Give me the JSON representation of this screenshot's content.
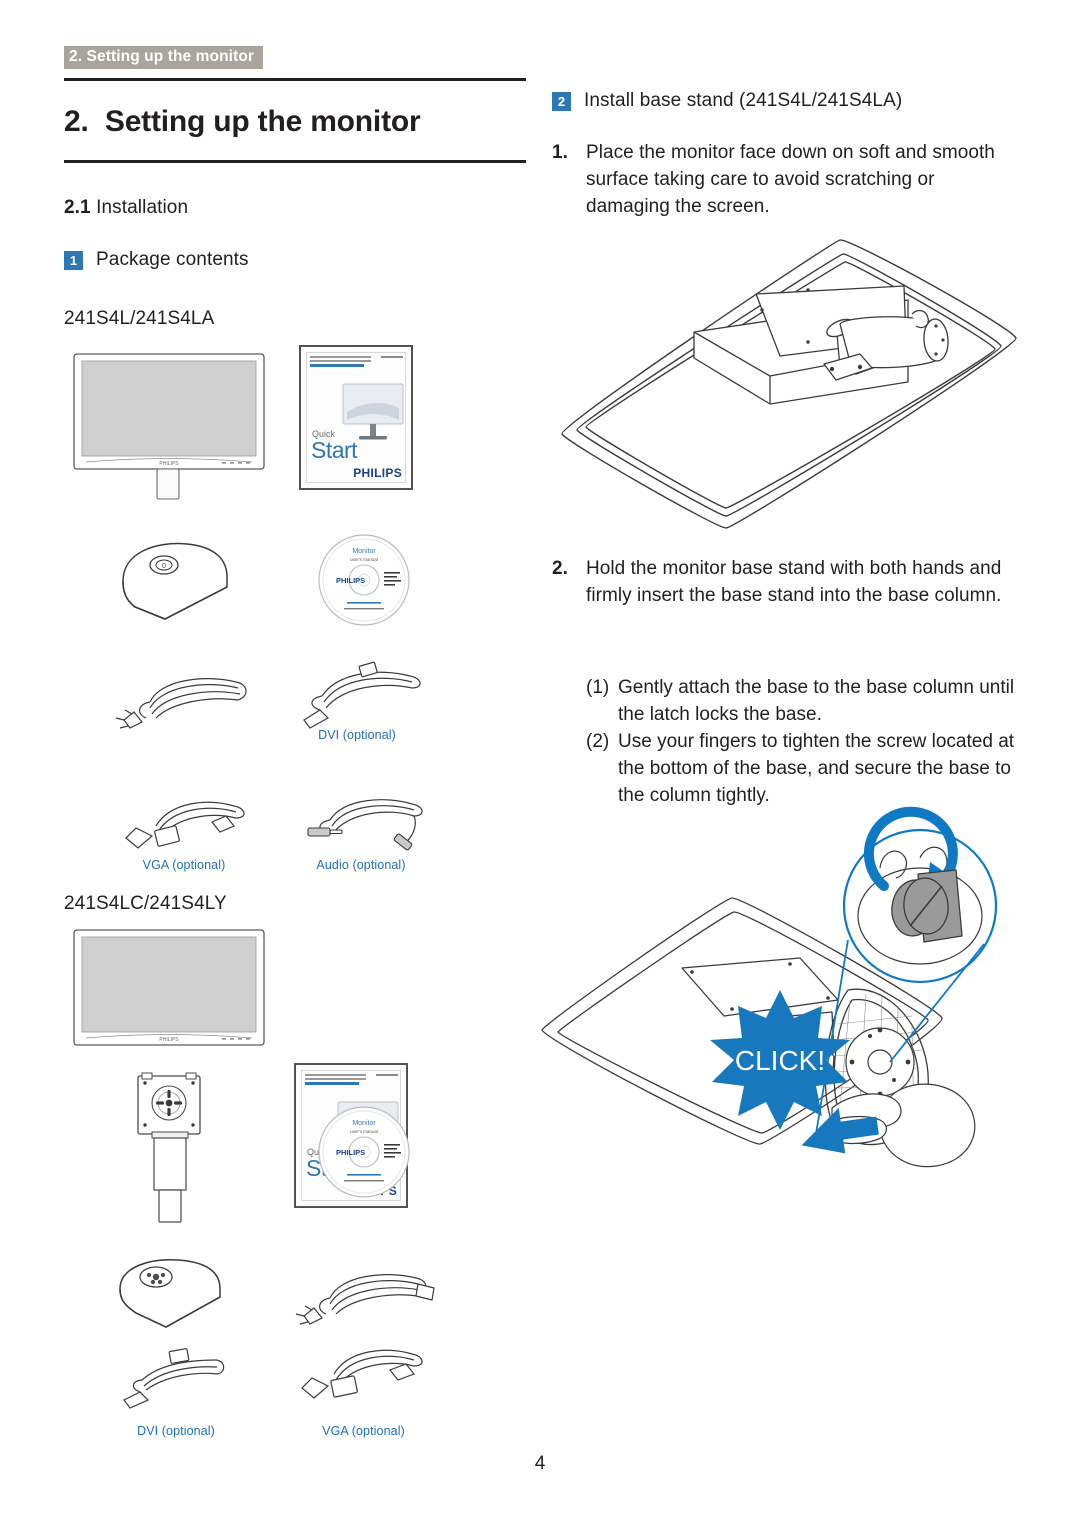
{
  "running_header": "2. Setting up the monitor",
  "page_number": "4",
  "left": {
    "chapter_title": "2.  Setting up the monitor",
    "section_number": "2.1",
    "section_title": "Installation",
    "subsection": {
      "chip": "1",
      "label": "Package contents"
    },
    "groups": [
      {
        "model": "241S4L/241S4LA",
        "captions": [
          "DVI  (optional)",
          "VGA  (optional)",
          "Audio  (optional)"
        ]
      },
      {
        "model": "241S4LC/241S4LY",
        "captions": [
          "DVI (optional)",
          "VGA (optional)"
        ]
      }
    ],
    "booklet": {
      "quick": "Quick",
      "start": "Start",
      "brand": "PHILIPS"
    },
    "disc": {
      "title": "Monitor",
      "subtitle": "user's manual",
      "brand": "PHILIPS"
    }
  },
  "right": {
    "heading": {
      "chip": "2",
      "label": "Install base stand (241S4L/241S4LA)"
    },
    "steps": [
      {
        "num": "1.",
        "text": "Place the monitor face down on soft and smooth surface taking care to avoid scratching or damaging the screen."
      },
      {
        "num": "2.",
        "text": "Hold the monitor base stand with both hands and firmly insert the base stand into the base column."
      }
    ],
    "substeps": [
      {
        "num": "(1)",
        "text": "Gently attach the base to the base column until the latch locks the base."
      },
      {
        "num": "(2)",
        "text": "Use your fingers to tighten the screw located at the bottom of the base, and secure the base to the column tightly."
      }
    ],
    "click_badge": "CLICK!"
  },
  "colors": {
    "header_band": "#a9a49c",
    "chip_blue": "#2e77b5",
    "caption_blue": "#1f6fc0",
    "accent_blue": "#0f7ac4",
    "text": "#231f20"
  }
}
